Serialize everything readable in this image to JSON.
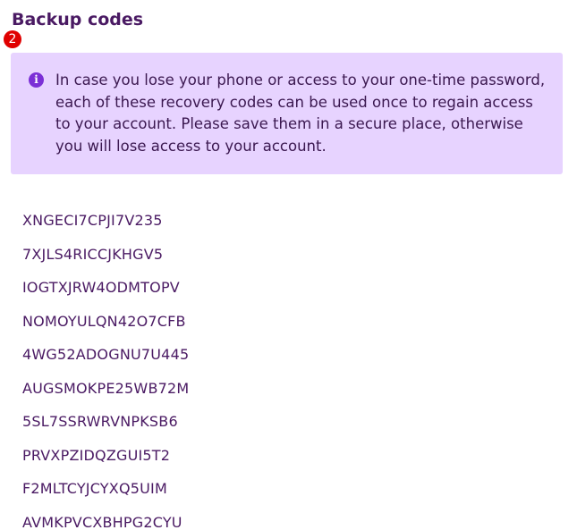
{
  "section": {
    "title": "Backup codes",
    "badge": "2"
  },
  "info": {
    "icon": "info-icon",
    "text": "In case you lose your phone or access to your one-time password, each of these recovery codes can be used once to regain access to your account. Please save them in a secure place, otherwise you will lose access to your account."
  },
  "codes": [
    "XNGECI7CPJI7V235",
    "7XJLS4RICCJKHGV5",
    "IOGTXJRW4ODMTOPV",
    "NOMOYULQN42O7CFB",
    "4WG52ADOGNU7U445",
    "AUGSMOKPE25WB72M",
    "5SL7SSRWRVNPKSB6",
    "PRVXPZIDQZGUI5T2",
    "F2MLTCYJCYXQ5UIM",
    "AVMKPVCXBHPG2CYU"
  ],
  "colors": {
    "title": "#4a1a63",
    "callout_bg": "#e7d3ff",
    "info_icon": "#7b2fd6",
    "badge": "#e00000"
  }
}
